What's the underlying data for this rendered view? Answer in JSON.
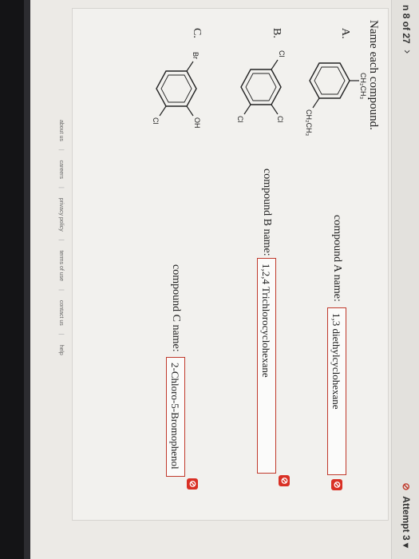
{
  "header": {
    "question_counter": "n 8 of 27",
    "next_glyph": "›",
    "attempt_label": "Attempt 3",
    "attempt_status_icon": "cross-circle-icon",
    "dropdown_glyph": "▾"
  },
  "question": {
    "prompt": "Name each compound."
  },
  "compounds": [
    {
      "label": "A.",
      "substituent_1": "CH₂CH₃",
      "substituent_2": "CH₂CH₃",
      "name_label": "compound A name:",
      "answer": "1,3 diethylcyclohexane",
      "status": "incorrect"
    },
    {
      "label": "B.",
      "substituent_1": "Cl",
      "substituent_2": "Cl",
      "substituent_3": "Cl",
      "name_label": "compound B name:",
      "answer": "1,2,4 Trichlorocyclohexane",
      "status": "incorrect"
    },
    {
      "label": "C.",
      "substituent_1": "Br",
      "substituent_2": "OH",
      "substituent_3": "Cl",
      "name_label": "compound C name:",
      "answer": "2-Chloro-5-Bromophenol",
      "status": "incorrect"
    }
  ],
  "status_icon_glyph": "⊘",
  "footer": {
    "links": [
      "about us",
      "careers",
      "privacy policy",
      "terms of use",
      "contact us",
      "help"
    ]
  },
  "colors": {
    "incorrect": "#d93025",
    "page_bg": "#eceae6",
    "bezel": "#141416"
  }
}
